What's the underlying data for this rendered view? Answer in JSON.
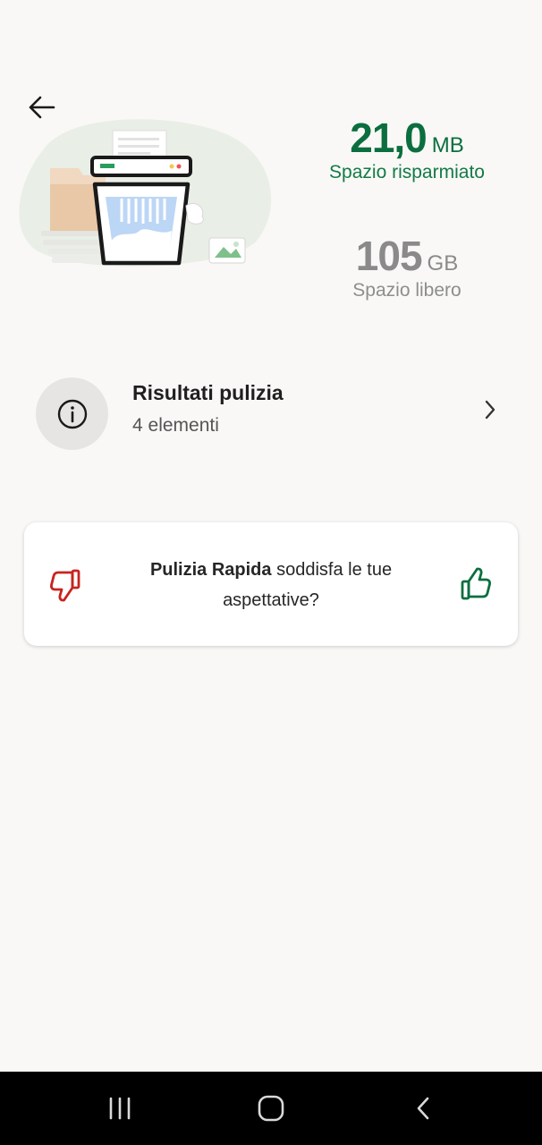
{
  "header": {
    "back_icon": "arrow-left-icon"
  },
  "stats": {
    "saved": {
      "value": "21,0",
      "unit": "MB",
      "label": "Spazio risparmiato"
    },
    "free": {
      "value": "105",
      "unit": "GB",
      "label": "Spazio libero"
    }
  },
  "results": {
    "icon": "info-icon",
    "title": "Risultati pulizia",
    "subtitle": "4 elementi",
    "chevron_icon": "chevron-right-icon"
  },
  "feedback": {
    "bold": "Pulizia Rapida",
    "text": " soddisfa le tue aspettative?",
    "thumb_down_icon": "thumb-down-icon",
    "thumb_up_icon": "thumb-up-icon"
  },
  "navbar": {
    "recents_icon": "recents-icon",
    "home_icon": "home-icon",
    "back_icon": "back-icon"
  },
  "colors": {
    "accent_green": "#0b6e3f",
    "thumb_down_red": "#c8231e",
    "background": "#f9f8f6"
  }
}
